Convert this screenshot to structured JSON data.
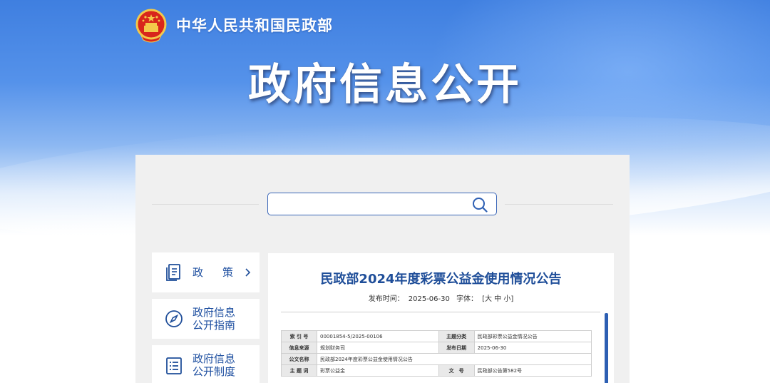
{
  "header": {
    "ministry_name": "中华人民共和国民政部",
    "page_title": "政府信息公开",
    "emblem_icon": "national-emblem-icon"
  },
  "search": {
    "value": "",
    "placeholder": "",
    "icon": "search-icon"
  },
  "sidebar": {
    "items": [
      {
        "label": "政　策",
        "icon": "document-icon",
        "has_chevron": true
      },
      {
        "label_line1": "政府信息",
        "label_line2": "公开指南",
        "icon": "compass-icon"
      },
      {
        "label_line1": "政府信息",
        "label_line2": "公开制度",
        "icon": "list-icon"
      }
    ]
  },
  "article": {
    "title": "民政部2024年度彩票公益金使用情况公告",
    "publish_label": "发布时间：",
    "publish_date": "2025-06-30",
    "font_label": "字体：",
    "font_sizes": "[大 中 小]"
  },
  "info_table": {
    "rows": [
      {
        "k1": "索 引 号",
        "v1": "00001854-5/2025-00106",
        "k2": "主题分类",
        "v2": "民政部彩票公益金情况公告"
      },
      {
        "k1": "信息来源",
        "v1": "规划财务司",
        "k2": "发布日期",
        "v2": "2025-06-30"
      },
      {
        "k1": "公文名称",
        "v1": "民政部2024年度彩票公益金使用情况公告"
      },
      {
        "k1": "主 题 词",
        "v1": "彩票公益金",
        "k2": "文　号",
        "v2": "民政部公告第582号"
      }
    ]
  },
  "colors": {
    "brand_blue": "#1f4e99",
    "accent_blue": "#2d5fb3",
    "hero_blue": "#3f7fe0"
  }
}
